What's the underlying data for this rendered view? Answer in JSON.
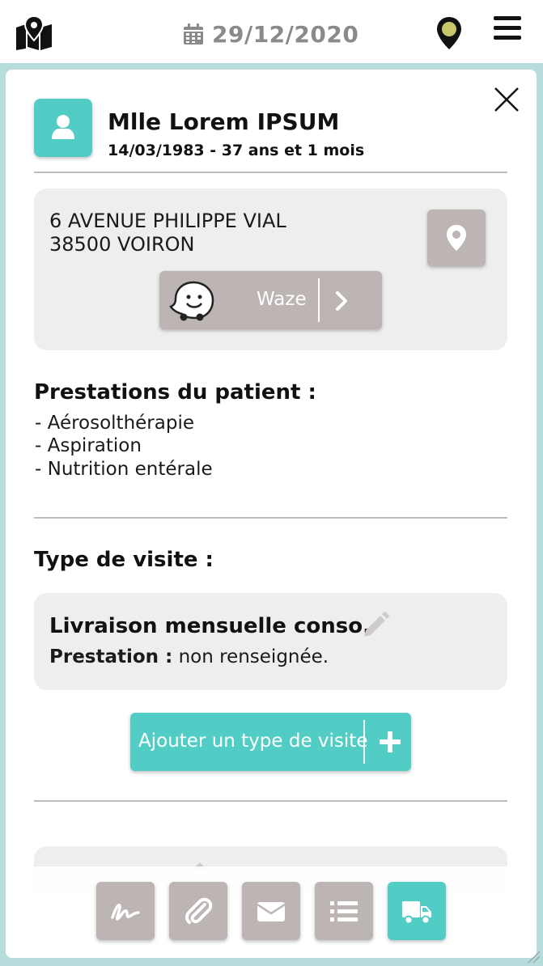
{
  "header": {
    "date": "29/12/2020",
    "icons": {
      "map": "map-marker-icon",
      "calendar": "calendar-icon",
      "location": "location-pin-icon",
      "menu": "hamburger-menu-icon"
    },
    "pin_color": "#c8c86a"
  },
  "patient": {
    "name": "Mlle Lorem IPSUM",
    "dob_age": "14/03/1983 - 37 ans et 1 mois"
  },
  "address": {
    "line1": "6 AVENUE PHILIPPE VIAL",
    "line2": "38500 VOIRON",
    "waze_label": "Waze"
  },
  "prestations": {
    "title": "Prestations du patient :",
    "items": [
      "- Aérosolthérapie",
      "- Aspiration",
      "- Nutrition entérale"
    ]
  },
  "visit": {
    "section_title": "Type de visite :",
    "type_title": "Livraison mensuelle conso.",
    "prestation_label": "Prestation :",
    "prestation_value": " non renseignée.",
    "add_button": "Ajouter un type de visite"
  },
  "toolbar": {
    "items": [
      "signature-icon",
      "paperclip-icon",
      "envelope-icon",
      "list-icon",
      "truck-icon"
    ],
    "active": "truck-icon"
  },
  "colors": {
    "accent": "#52cdc6",
    "button_grey": "#bdb4b4",
    "box_bg": "#eeeeee",
    "page_bg": "#b6dcdb"
  }
}
